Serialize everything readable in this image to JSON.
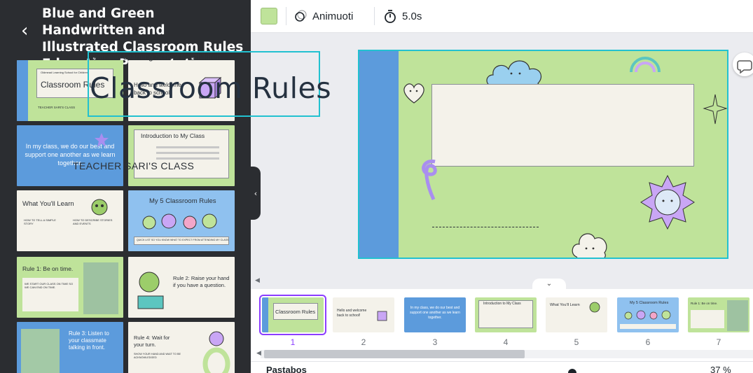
{
  "panel": {
    "back_label": "‹",
    "title": "Blue and Green Handwritten and Illustrated Classroom Rules Education Presentation",
    "templates": [
      {
        "title": "Classroom Rules",
        "subtitle": "Oldmead Learning School for Children",
        "footer": "TEACHER SARI'S CLASS"
      },
      {
        "title": "Hello and welcome back to school!"
      },
      {
        "title": "In my class, we do our best and support one another as we learn together."
      },
      {
        "title": "Introduction to My Class"
      },
      {
        "title": "What You'll Learn",
        "col1": "HOW TO TELL A SIMPLE STORY",
        "col2": "HOW TO DESCRIBE STORIES AND EVENTS"
      },
      {
        "title": "My 5 Classroom Rules",
        "footer": "QUICK LIST SO YOU KNOW WHAT TO EXPECT FROM ATTENDING MY CLASS"
      },
      {
        "title": "Rule 1: Be on time.",
        "body": "WE START OUR CLASS ON TIME SO WE CAN END ON TIME."
      },
      {
        "title": "Rule 2: Raise your hand if you have a question."
      },
      {
        "title": "Rule 3: Listen to your classmate talking in front."
      },
      {
        "title": "Rule 4: Wait for your turn.",
        "body": "SHOW YOUR HAND AND WAIT TO BE ACKNOWLEDGED"
      }
    ]
  },
  "toolbar": {
    "color": "#bfe39a",
    "animate_label": "Animuoti",
    "timing_label": "5.0s"
  },
  "slide": {
    "school": "Oldmead Learning School for Children",
    "title": "Classroom Rules",
    "teacher": "TEACHER SARI'S CLASS"
  },
  "filmstrip": {
    "pages": [
      {
        "num": "1",
        "label": "Classroom Rules",
        "selected": true
      },
      {
        "num": "2",
        "label": "Hello and welcome back to school!"
      },
      {
        "num": "3",
        "label": "In my class, we do our best and support one another as we learn together."
      },
      {
        "num": "4",
        "label": "Introduction to My Class"
      },
      {
        "num": "5",
        "label": "What You'll Learn"
      },
      {
        "num": "6",
        "label": "My 5 Classroom Rules"
      },
      {
        "num": "7",
        "label": "Rule 1: Be on time."
      }
    ]
  },
  "bottom": {
    "notes_label": "Pastabos",
    "zoom_label": "37 %"
  },
  "colors": {
    "accent": "#8b3dff",
    "selection": "#22c1d0",
    "slide_green": "#bfe39a",
    "slide_blue": "#5c9bdc",
    "panel_bg": "#2b2d31"
  }
}
